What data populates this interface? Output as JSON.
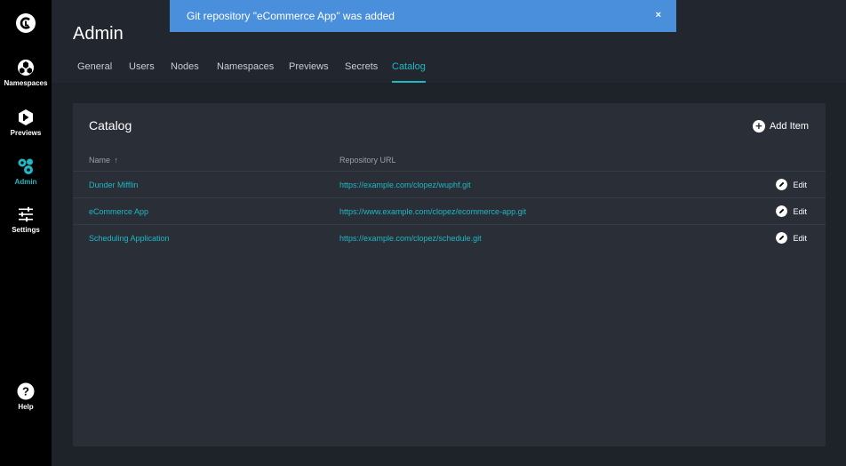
{
  "toast": {
    "message": "Git repository \"eCommerce App\" was added",
    "close_symbol": "×",
    "color": "#4a8fdc"
  },
  "sidebar": {
    "logo_icon": "logo-c-icon",
    "items": [
      {
        "label": "Namespaces",
        "icon": "cube-cluster-icon",
        "active": false
      },
      {
        "label": "Previews",
        "icon": "preview-icon",
        "active": false
      },
      {
        "label": "Admin",
        "icon": "admin-icon",
        "active": true
      },
      {
        "label": "Settings",
        "icon": "sliders-icon",
        "active": false
      },
      {
        "label": "Help",
        "icon": "help-icon",
        "active": false
      }
    ]
  },
  "header": {
    "title": "Admin",
    "tabs": [
      {
        "label": "General",
        "active": false
      },
      {
        "label": "Users",
        "active": false
      },
      {
        "label": "Nodes",
        "active": false
      },
      {
        "label": "Namespaces",
        "active": false
      },
      {
        "label": "Previews",
        "active": false
      },
      {
        "label": "Secrets",
        "active": false
      },
      {
        "label": "Catalog",
        "active": true
      }
    ]
  },
  "catalog": {
    "title": "Catalog",
    "add_label": "Add Item",
    "columns": {
      "name": "Name",
      "sort_arrow": "↑",
      "url": "Repository URL"
    },
    "edit_label": "Edit",
    "rows": [
      {
        "name": "Dunder Mifflin",
        "url": "https://example.com/clopez/wuphf.git"
      },
      {
        "name": "eCommerce App",
        "url": "https://www.example.com/clopez/ecommerce-app.git"
      },
      {
        "name": "Scheduling Application",
        "url": "https://example.com/clopez/schedule.git"
      }
    ]
  },
  "colors": {
    "accent": "#1fb8c4",
    "background": "#1e2229",
    "card": "#2a2e37",
    "sidebar": "#000000"
  }
}
